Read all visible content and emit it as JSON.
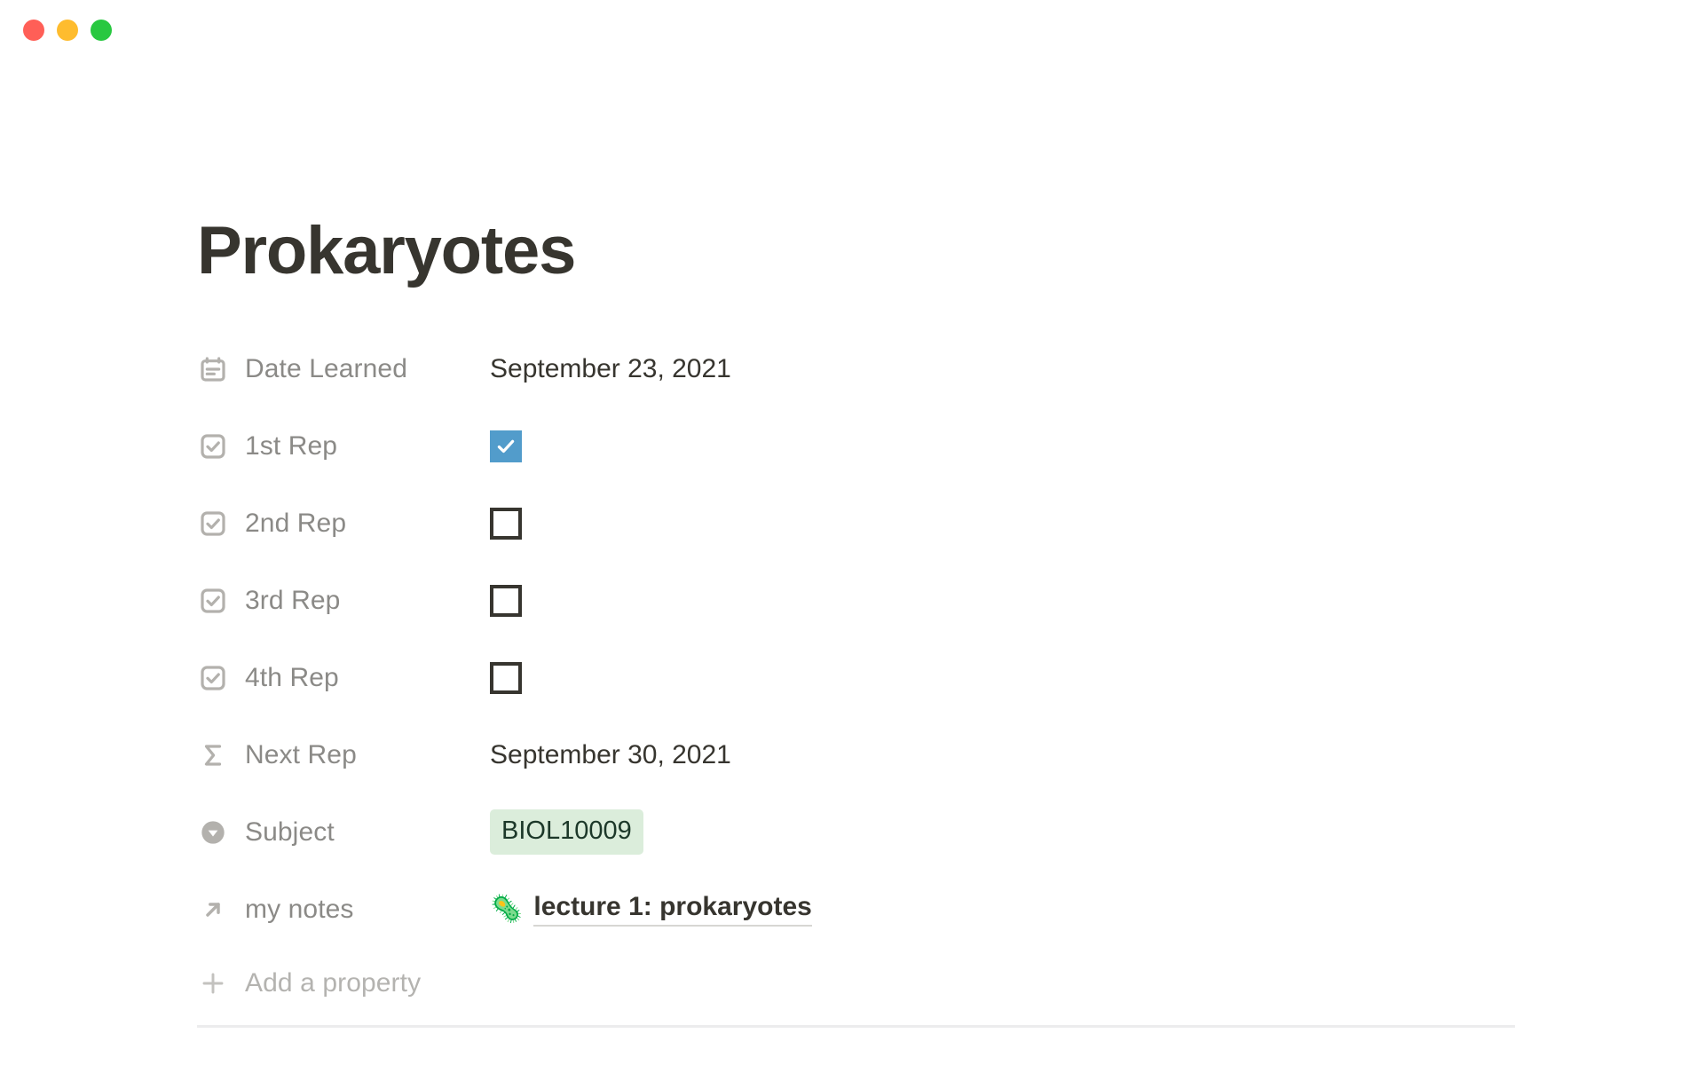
{
  "window": {
    "controls": [
      {
        "name": "close",
        "color": "#ff5f57"
      },
      {
        "name": "minimize",
        "color": "#febc2e"
      },
      {
        "name": "maximize",
        "color": "#28c840"
      }
    ]
  },
  "page": {
    "title": "Prokaryotes",
    "title_color": "#37352f"
  },
  "properties": [
    {
      "icon": "calendar-icon",
      "label": "Date Learned",
      "type": "date",
      "value": "September 23, 2021"
    },
    {
      "icon": "checkbox-icon",
      "label": "1st Rep",
      "type": "checkbox",
      "checked": true
    },
    {
      "icon": "checkbox-icon",
      "label": "2nd Rep",
      "type": "checkbox",
      "checked": false
    },
    {
      "icon": "checkbox-icon",
      "label": "3rd Rep",
      "type": "checkbox",
      "checked": false
    },
    {
      "icon": "checkbox-icon",
      "label": "4th Rep",
      "type": "checkbox",
      "checked": false
    },
    {
      "icon": "sigma-formula-icon",
      "label": "Next Rep",
      "type": "formula",
      "value": "September 30, 2021"
    },
    {
      "icon": "select-chevron-circle-icon",
      "label": "Subject",
      "type": "select",
      "tag": "BIOL10009",
      "tag_bg": "#dbeddb",
      "tag_fg": "#1c3829"
    },
    {
      "icon": "relation-arrow-icon",
      "label": "my notes",
      "type": "relation",
      "emoji": "🦠",
      "link_text": "lecture 1: prokaryotes"
    }
  ],
  "add_property": {
    "icon": "plus-icon",
    "label": "Add a property"
  },
  "colors": {
    "checkbox_checked": "#529ccb",
    "checkbox_border": "#37352f",
    "property_label": "#8b8a87",
    "property_value": "#37352f",
    "divider": "#ececed"
  }
}
